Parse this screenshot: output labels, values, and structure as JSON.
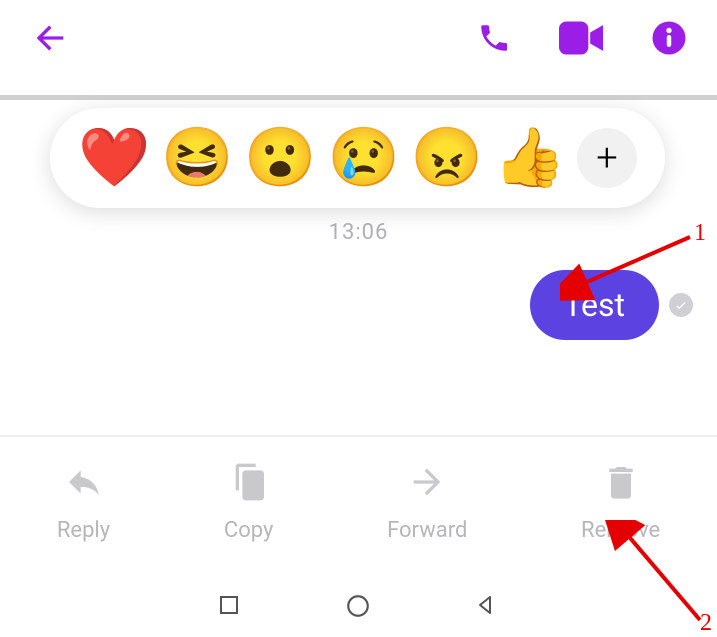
{
  "colors": {
    "accent": "#9b1ee6",
    "bubble": "#5c42e0",
    "muted": "#b7b7bb",
    "annotation": "#e40000"
  },
  "timestamp": "13:06",
  "message": {
    "text": "Test"
  },
  "reactions": {
    "heart": "❤️",
    "laugh": "😆",
    "wow": "😮",
    "sad": "😢",
    "angry": "😠",
    "like": "👍",
    "add": "+"
  },
  "actions": {
    "reply": "Reply",
    "copy": "Copy",
    "forward": "Forward",
    "remove": "Remove"
  },
  "annotations": {
    "one": "1",
    "two": "2"
  }
}
